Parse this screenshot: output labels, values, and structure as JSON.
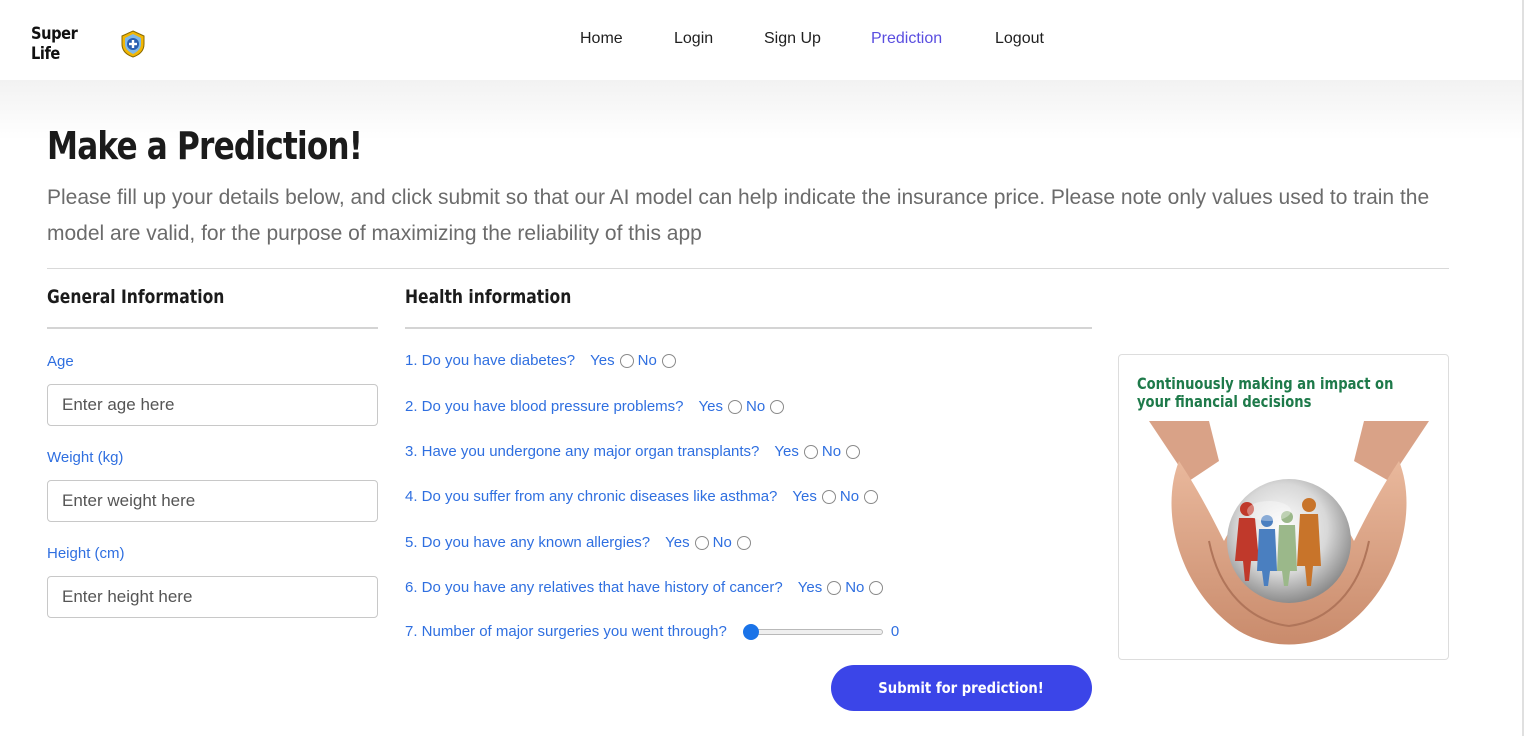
{
  "brand": {
    "name": "Super Life",
    "icon": "shield-plus-icon"
  },
  "nav": {
    "items": [
      {
        "label": "Home",
        "active": false
      },
      {
        "label": "Login",
        "active": false
      },
      {
        "label": "Sign Up",
        "active": false
      },
      {
        "label": "Prediction",
        "active": true
      },
      {
        "label": "Logout",
        "active": false
      }
    ],
    "active_color": "#5a4ee0"
  },
  "page": {
    "title": "Make a Prediction!",
    "description": "Please fill up your details below, and click submit so that our AI model can help indicate the insurance price. Please note only values used to train the model are valid, for the purpose of maximizing the reliability of this app"
  },
  "general": {
    "heading": "General Information",
    "fields": [
      {
        "label": "Age",
        "placeholder": "Enter age here",
        "value": ""
      },
      {
        "label": "Weight (kg)",
        "placeholder": "Enter weight here",
        "value": ""
      },
      {
        "label": "Height (cm)",
        "placeholder": "Enter height here",
        "value": ""
      }
    ]
  },
  "health": {
    "heading": "Health information",
    "yes_label": "Yes",
    "no_label": "No",
    "questions": [
      "1. Do you have diabetes?",
      "2. Do you have blood pressure problems?",
      "3. Have you undergone any major organ transplants?",
      "4. Do you suffer from any chronic diseases like asthma?",
      "5. Do you have any known allergies?",
      "6. Do you have any relatives that have history of cancer?"
    ],
    "surgeries": {
      "question": "7. Number of major surgeries you went through?",
      "value": "0",
      "min": 0,
      "max": 3
    }
  },
  "submit_label": "Submit for prediction!",
  "promo": {
    "title": "Continuously making an impact on your financial decisions",
    "image": "hands-holding-family-sphere-image"
  },
  "colors": {
    "accent_blue": "#2f6fe0",
    "button": "#3b45e8",
    "promo_green": "#1e7a4a"
  }
}
